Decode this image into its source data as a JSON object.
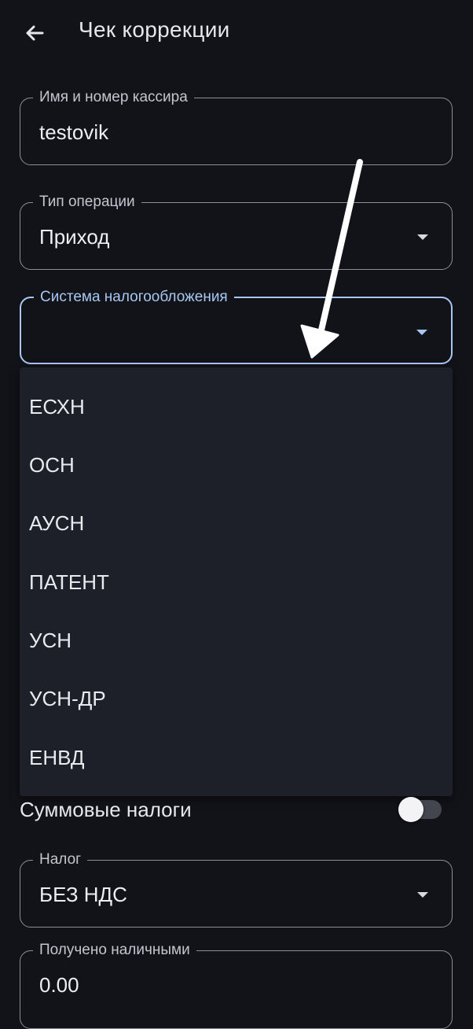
{
  "appbar": {
    "title": "Чек коррекции",
    "back_icon": "arrow-left-icon"
  },
  "fields": {
    "cashier": {
      "label": "Имя и номер кассира",
      "value": "testovik"
    },
    "operation_type": {
      "label": "Тип операции",
      "value": "Приход"
    },
    "tax_system": {
      "label": "Система налогообложения",
      "value": ""
    },
    "tax": {
      "label": "Налог",
      "value": "БЕЗ НДС"
    },
    "cash_received": {
      "label": "Получено наличными",
      "value": "0.00"
    }
  },
  "tax_system_menu": {
    "items": [
      "ЕСХН",
      "ОСН",
      "АУСН",
      "ПАТЕНТ",
      "УСН",
      "УСН-ДР",
      "ЕНВД"
    ]
  },
  "sum_taxes": {
    "label": "Суммовые налоги",
    "enabled": false
  },
  "colors": {
    "background": "#111318",
    "accent": "#a8c8f2",
    "menu": "#1d2028"
  }
}
